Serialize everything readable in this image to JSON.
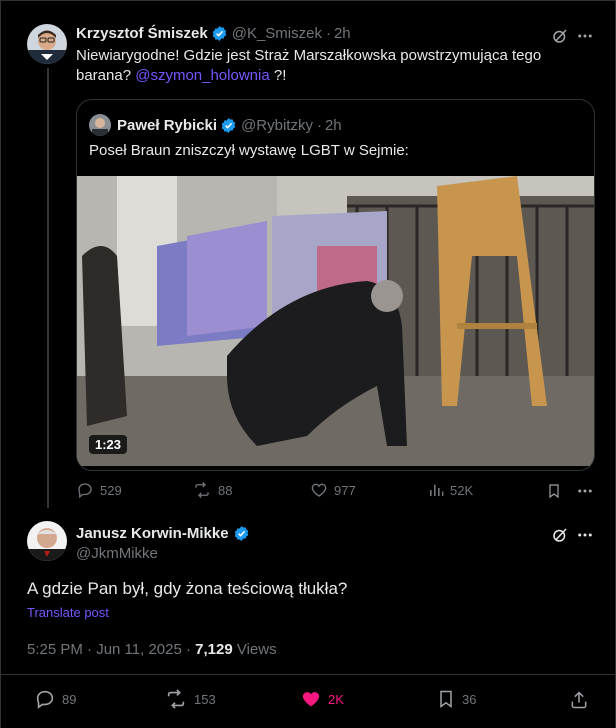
{
  "parent_tweet": {
    "author_name": "Krzysztof Śmiszek",
    "handle": "@K_Smiszek",
    "dot": "·",
    "time": "2h",
    "text_prefix": "Niewiarygodne! Gdzie jest Straż Marszałkowska powstrzymująca tego barana? ",
    "mention": "@szymon_holownia",
    "text_suffix": " ?!",
    "quote": {
      "author_name": "Paweł Rybicki",
      "handle": "@Rybitzky",
      "dot": "·",
      "time": "2h",
      "text": "Poseł Braun zniszczył wystawę LGBT w Sejmie:",
      "video_duration": "1:23"
    },
    "stats": {
      "replies": "529",
      "reposts": "88",
      "likes": "977",
      "views": "52K"
    }
  },
  "main_tweet": {
    "author_name": "Janusz Korwin-Mikke",
    "handle": "@JkmMikke",
    "text": "A gdzie Pan był, gdy żona teściową tłukła?",
    "translate_label": "Translate post",
    "timestamp": "5:25 PM · Jun 11, 2025 · ",
    "views_count": "7,129",
    "views_label": " Views",
    "stats": {
      "replies": "89",
      "reposts": "153",
      "likes": "2K",
      "bookmarks": "36"
    }
  },
  "colors": {
    "accent": "#7856ff",
    "like_active": "#f91880",
    "verified": "#1d9bf0",
    "muted": "#71767b",
    "border": "#2f3336"
  },
  "icons": [
    "grok-icon",
    "more-icon",
    "reply-icon",
    "repost-icon",
    "like-icon",
    "views-icon",
    "bookmark-icon",
    "share-icon",
    "verified-badge-icon"
  ]
}
